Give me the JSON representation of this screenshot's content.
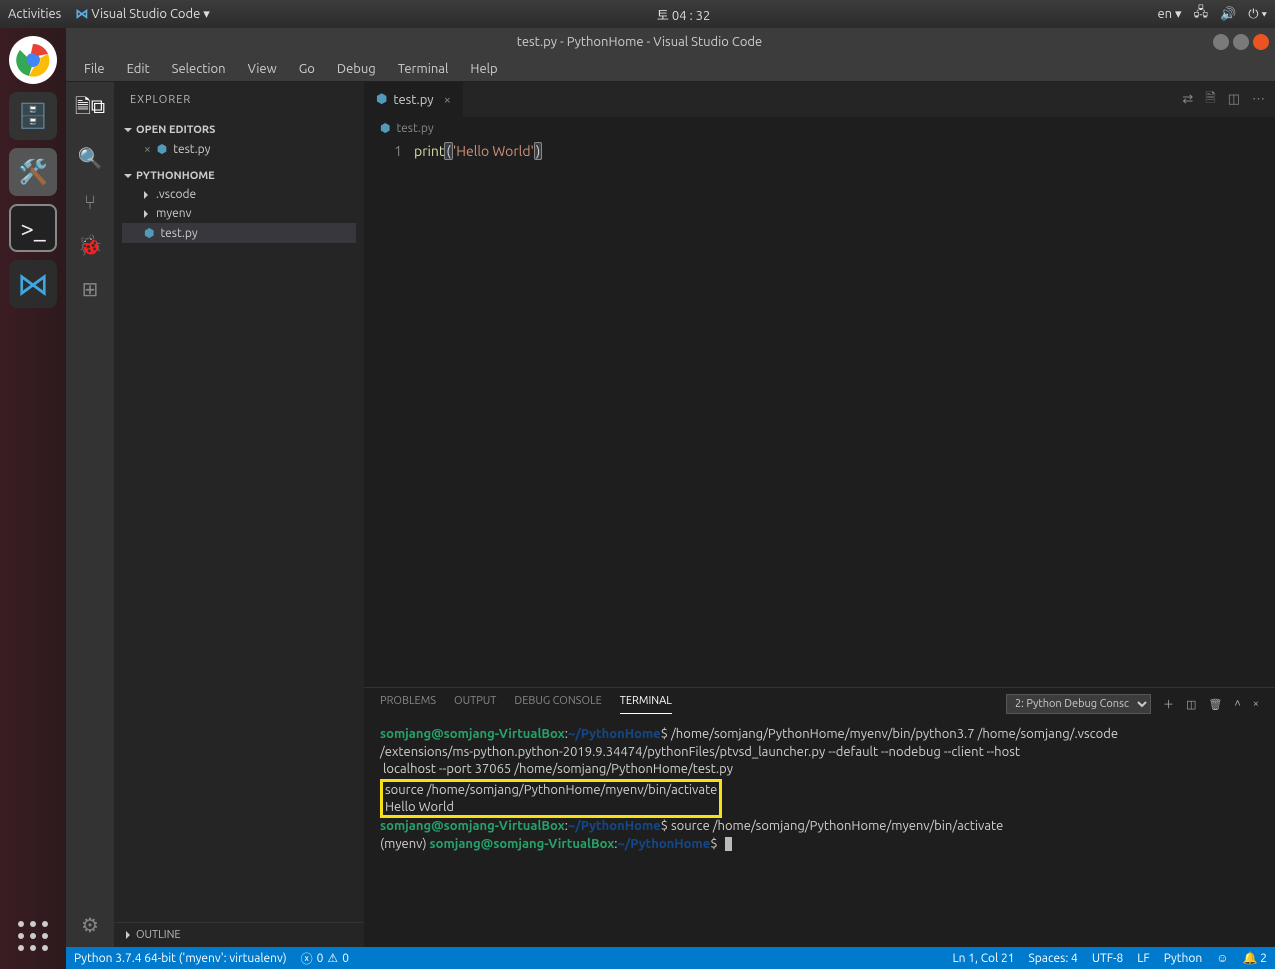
{
  "gnome": {
    "activities": "Activities",
    "app_name": "Visual Studio Code",
    "clock": "토 04 : 32",
    "lang": "en"
  },
  "window": {
    "title": "test.py - PythonHome - Visual Studio Code"
  },
  "menu": [
    "File",
    "Edit",
    "Selection",
    "View",
    "Go",
    "Debug",
    "Terminal",
    "Help"
  ],
  "explorer": {
    "title": "EXPLORER",
    "open_editors": "OPEN EDITORS",
    "workspace": "PYTHONHOME",
    "open_file": "test.py",
    "tree": {
      "vscode_folder": ".vscode",
      "myenv": "myenv",
      "test_py": "test.py"
    },
    "outline": "OUTLINE"
  },
  "tab": {
    "name": "test.py"
  },
  "breadcrumb": {
    "file": "test.py"
  },
  "code": {
    "line_no": "1",
    "fn": "print",
    "open": "(",
    "str": "'Hello World'",
    "close": ")"
  },
  "panel": {
    "tabs": {
      "problems": "PROBLEMS",
      "output": "OUTPUT",
      "debug": "DEBUG CONSOLE",
      "terminal": "TERMINAL"
    },
    "dropdown": "2: Python Debug Consc"
  },
  "terminal": {
    "prompt_user": "somjang@somjang-VirtualBox",
    "prompt_path": "~/PythonHome",
    "dollar": "$",
    "cmd1a": " /home/somjang/PythonHome/myenv/bin/python3.7 /home/somjang/.vscode",
    "cmd1b": "/extensions/ms-python.python-2019.9.34474/pythonFiles/ptvsd_launcher.py --default --nodebug --client --host",
    "cmd1c": " localhost --port 37065 /home/somjang/PythonHome/test.py",
    "source_hidden": "source /home/somjang/PythonHome/myenv/bin/activate",
    "output": "Hello World",
    "cmd2": " source /home/somjang/PythonHome/myenv/bin/activate",
    "env": "(myenv) "
  },
  "status": {
    "python": "Python 3.7.4 64-bit ('myenv': virtualenv)",
    "errors": "0",
    "warnings": "0",
    "cursor": "Ln 1, Col 21",
    "spaces": "Spaces: 4",
    "encoding": "UTF-8",
    "eol": "LF",
    "lang": "Python",
    "notif": "2"
  }
}
